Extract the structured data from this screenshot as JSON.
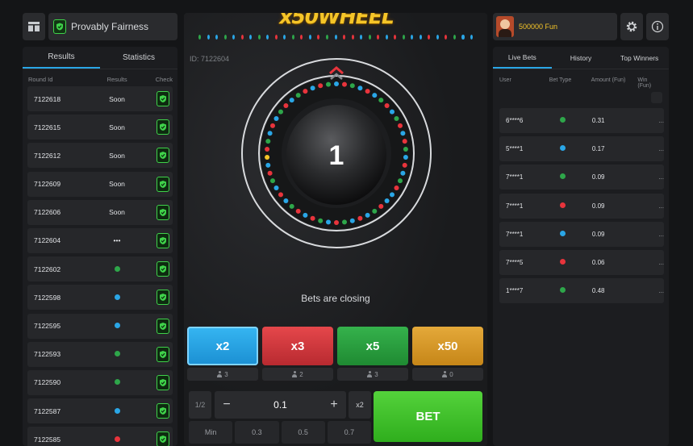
{
  "colors": {
    "blue": "#2aa6e6",
    "red": "#e8343c",
    "green": "#2ea64a",
    "gold": "#f5c528"
  },
  "left": {
    "fairness_label": "Provably Fairness",
    "tabs": [
      "Results",
      "Statistics"
    ],
    "columns": [
      "Round Id",
      "Results",
      "Check"
    ],
    "rows": [
      {
        "id": "7122618",
        "result": "Soon",
        "type": "text"
      },
      {
        "id": "7122615",
        "result": "Soon",
        "type": "text"
      },
      {
        "id": "7122612",
        "result": "Soon",
        "type": "text"
      },
      {
        "id": "7122609",
        "result": "Soon",
        "type": "text"
      },
      {
        "id": "7122606",
        "result": "Soon",
        "type": "text"
      },
      {
        "id": "7122604",
        "result": "•••",
        "type": "text"
      },
      {
        "id": "7122602",
        "result": "green",
        "type": "dot"
      },
      {
        "id": "7122598",
        "result": "blue",
        "type": "dot"
      },
      {
        "id": "7122595",
        "result": "blue",
        "type": "dot"
      },
      {
        "id": "7122593",
        "result": "green",
        "type": "dot"
      },
      {
        "id": "7122590",
        "result": "green",
        "type": "dot"
      },
      {
        "id": "7122587",
        "result": "blue",
        "type": "dot"
      },
      {
        "id": "7122585",
        "result": "red",
        "type": "dot"
      }
    ]
  },
  "center": {
    "logo": "x50WHEEL",
    "round_id": "ID: 7122604",
    "countdown": "1",
    "status": "Bets are closing",
    "history": [
      "green",
      "blue",
      "blue",
      "green",
      "blue",
      "red",
      "blue",
      "green",
      "blue",
      "red",
      "blue",
      "green",
      "red",
      "blue",
      "red",
      "green",
      "blue",
      "red",
      "red",
      "blue",
      "green",
      "red",
      "blue",
      "red",
      "green",
      "blue",
      "blue",
      "red",
      "blue",
      "red",
      "green",
      "blue",
      "blue"
    ],
    "multipliers": [
      {
        "label": "x2",
        "count": "3",
        "color": "blue"
      },
      {
        "label": "x3",
        "count": "2",
        "color": "red"
      },
      {
        "label": "x5",
        "count": "3",
        "color": "green"
      },
      {
        "label": "x50",
        "count": "0",
        "color": "gold"
      }
    ],
    "half_label": "1/2",
    "double_label": "x2",
    "minus": "−",
    "plus": "+",
    "amount": "0.1",
    "quick_amounts": [
      "Min",
      "0.3",
      "0.5",
      "0.7"
    ],
    "bet_label": "BET"
  },
  "right": {
    "balance": "500000 Fun",
    "tabs": [
      "Live Bets",
      "History",
      "Top Winners"
    ],
    "columns": [
      "User",
      "Bet Type",
      "Amount (Fun)",
      "Win (Fun)"
    ],
    "rows": [
      {
        "user": "6****6",
        "color": "green",
        "amount": "0.31",
        "win": "..."
      },
      {
        "user": "5****1",
        "color": "blue",
        "amount": "0.17",
        "win": "..."
      },
      {
        "user": "7****1",
        "color": "green",
        "amount": "0.09",
        "win": "..."
      },
      {
        "user": "7****1",
        "color": "red",
        "amount": "0.09",
        "win": "..."
      },
      {
        "user": "7****1",
        "color": "blue",
        "amount": "0.09",
        "win": "..."
      },
      {
        "user": "7****5",
        "color": "red",
        "amount": "0.06",
        "win": "..."
      },
      {
        "user": "1****7",
        "color": "green",
        "amount": "0.48",
        "win": "..."
      }
    ]
  }
}
